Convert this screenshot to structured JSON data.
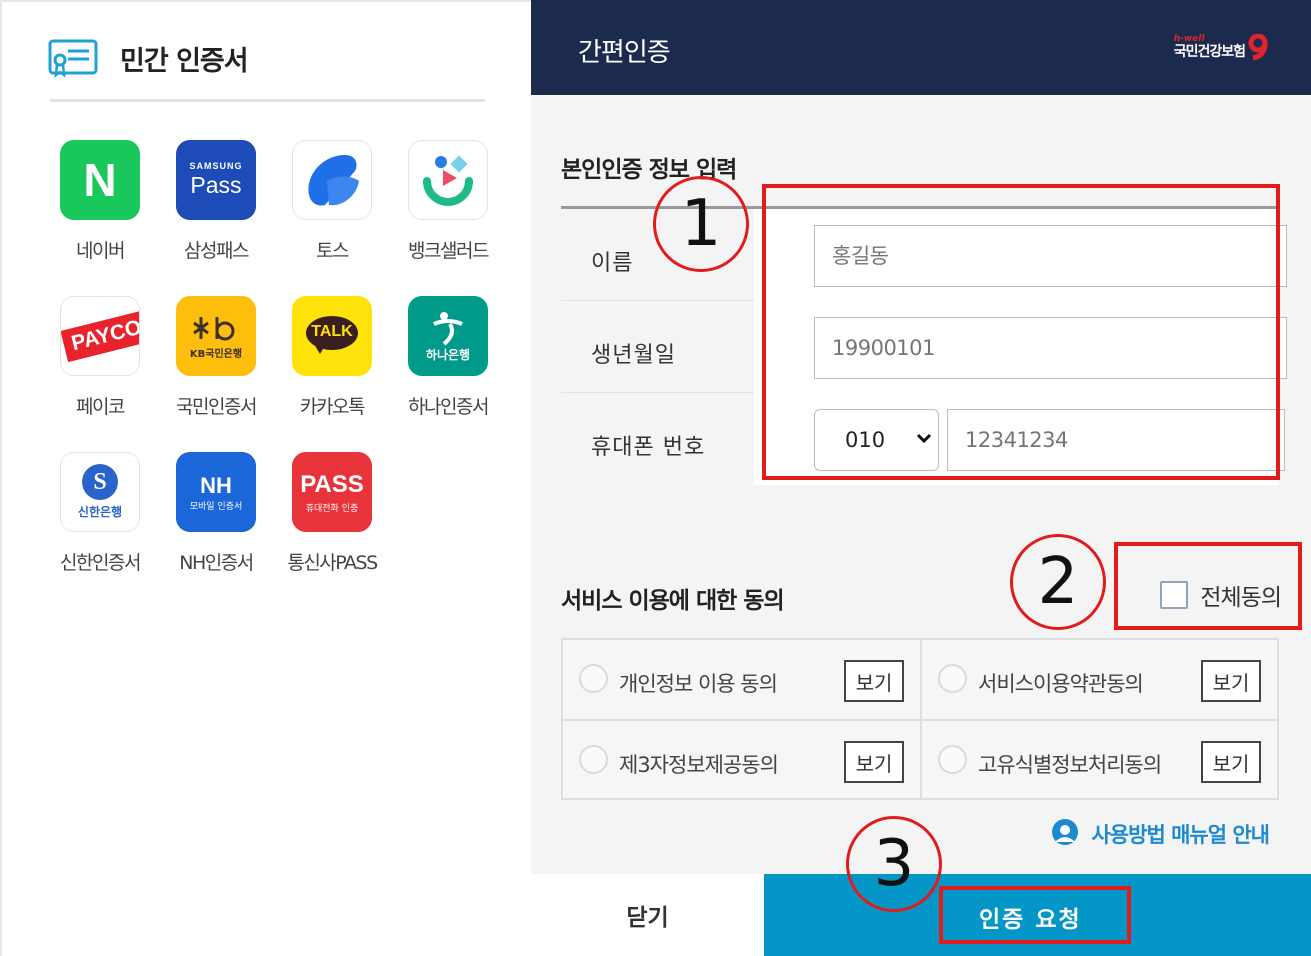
{
  "left_panel": {
    "title": "민간 인증서",
    "apps": [
      {
        "label": "네이버",
        "icon": "naver-icon",
        "text": "N",
        "color": "#19c75a"
      },
      {
        "label": "삼성패스",
        "icon": "samsung-pass-icon",
        "text_top": "SAMSUNG",
        "text": "Pass",
        "color": "#1d4bb8"
      },
      {
        "label": "토스",
        "icon": "toss-icon",
        "color": "#1f6fe8"
      },
      {
        "label": "뱅크샐러드",
        "icon": "banksalad-icon",
        "color": "#1dbb8a"
      },
      {
        "label": "페이코",
        "icon": "payco-icon",
        "text": "PAYCO",
        "color": "#e8232d"
      },
      {
        "label": "국민인증서",
        "icon": "kb-icon",
        "text": "KB국민은행",
        "color": "#ffbd0c"
      },
      {
        "label": "카카오톡",
        "icon": "kakaotalk-icon",
        "text": "TALK",
        "color": "#ffe20a"
      },
      {
        "label": "하나인증서",
        "icon": "hana-icon",
        "text": "하나은행",
        "color": "#009a8a"
      },
      {
        "label": "신한인증서",
        "icon": "shinhan-icon",
        "text": "신한은행",
        "color": "#2a63c9"
      },
      {
        "label": "NH인증서",
        "icon": "nh-icon",
        "text_top": "NH",
        "text": "모바일 인증서",
        "color": "#1b66d8"
      },
      {
        "label": "통신사PASS",
        "icon": "pass-icon",
        "text_top": "PASS",
        "text": "휴대전화 인증",
        "color": "#e8333b"
      }
    ]
  },
  "header": {
    "title": "간편인증",
    "brand_small": "h-well",
    "brand_name": "국민건강보험"
  },
  "identity": {
    "section_title": "본인인증 정보 입력",
    "name_label": "이름",
    "name_placeholder": "홍길동",
    "birth_label": "생년월일",
    "birth_placeholder": "19900101",
    "phone_label": "휴대폰 번호",
    "phone_prefix": "010",
    "phone_placeholder": "12341234"
  },
  "consent": {
    "section_title": "서비스 이용에 대한 동의",
    "agree_all_label": "전체동의",
    "items": [
      {
        "label": "개인정보 이용 동의",
        "view": "보기"
      },
      {
        "label": "서비스이용약관동의",
        "view": "보기"
      },
      {
        "label": "제3자정보제공동의",
        "view": "보기"
      },
      {
        "label": "고유식별정보처리동의",
        "view": "보기"
      }
    ]
  },
  "manual_link": "사용방법 매뉴얼 안내",
  "footer": {
    "close_label": "닫기",
    "submit_label": "인증 요청"
  },
  "annotations": {
    "step1": "1",
    "step2": "2",
    "step3": "3",
    "color": "#e21b1b"
  }
}
